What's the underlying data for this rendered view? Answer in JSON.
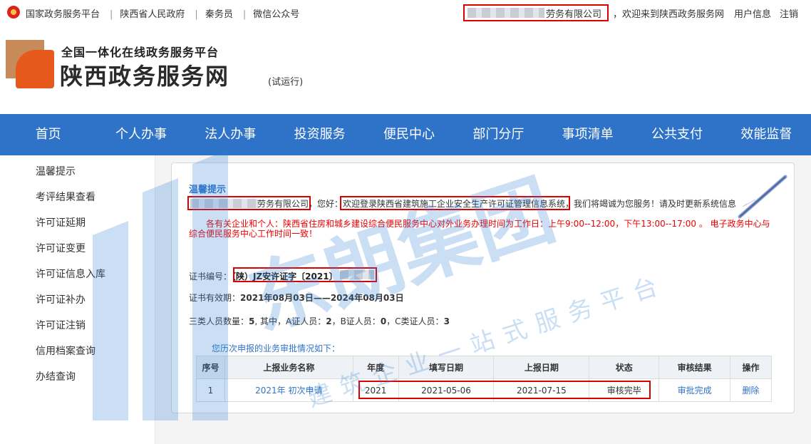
{
  "topbar": {
    "left_links": [
      "国家政务服务平台",
      "陕西省人民政府",
      "秦务员",
      "微信公众号"
    ],
    "company_name": "劳务有限公司",
    "welcome": "，欢迎来到陕西政务服务网",
    "user_info": "用户信息",
    "logout": "注销"
  },
  "header": {
    "subtitle": "全国一体化在线政务服务平台",
    "title": "陕西政务服务网",
    "trial": "(试运行)"
  },
  "nav": [
    "首页",
    "个人办事",
    "法人办事",
    "投资服务",
    "便民中心",
    "部门分厅",
    "事项清单",
    "公共支付",
    "效能监督"
  ],
  "sidebar": [
    "温馨提示",
    "考评结果查看",
    "许可证延期",
    "许可证变更",
    "许可证信息入库",
    "许可证补办",
    "许可证注销",
    "信用档案查询",
    "办结查询"
  ],
  "panel": {
    "heading": "温馨提示",
    "company": "劳务有限公司",
    "greeting": "，您好：",
    "system_name": "欢迎登录陕西省建筑施工企业安全生产许可证管理信息系统",
    "service_note": "，我们将竭诚为您服务！请及时更新系统信息",
    "notice": "各有关企业和个人：陕西省住房和城乡建设综合便民服务中心对外业务办理时间为工作日：上午9:00--12:00，下午13:00--17:00 。 电子政务中心与综合便民服务中心工作时间一致！",
    "cert_label": "证书编号：",
    "cert_value": "（陕）JZ安许证字〔2021〕",
    "validity_label": "证书有效期：",
    "validity_value": "2021年08月03日——2024年08月03日",
    "staff_text_1": "三类人员数量：",
    "staff_total": "5",
    "staff_text_2": ", 其中，A证人员：",
    "staff_a": "2",
    "staff_text_3": "，B证人员：",
    "staff_b": "0",
    "staff_text_4": "，C类证人员：",
    "staff_c": "3",
    "history_title": "您历次申报的业务审批情况如下："
  },
  "table": {
    "headers": [
      "序号",
      "上报业务名称",
      "年度",
      "填写日期",
      "上报日期",
      "状态",
      "审核结果",
      "操作"
    ],
    "rows": [
      {
        "no": "1",
        "name": "2021年 初次申请",
        "year": "2021",
        "fill_date": "2021-05-06",
        "report_date": "2021-07-15",
        "status": "审核完毕",
        "result": "审批完成",
        "action": "删除"
      }
    ]
  },
  "watermark": {
    "brand": "东朗集团",
    "slogan": "建筑企业一站式服务平台"
  },
  "colors": {
    "nav_blue": "#2f73c8",
    "red": "#dd0000",
    "link": "#2f73c8"
  }
}
